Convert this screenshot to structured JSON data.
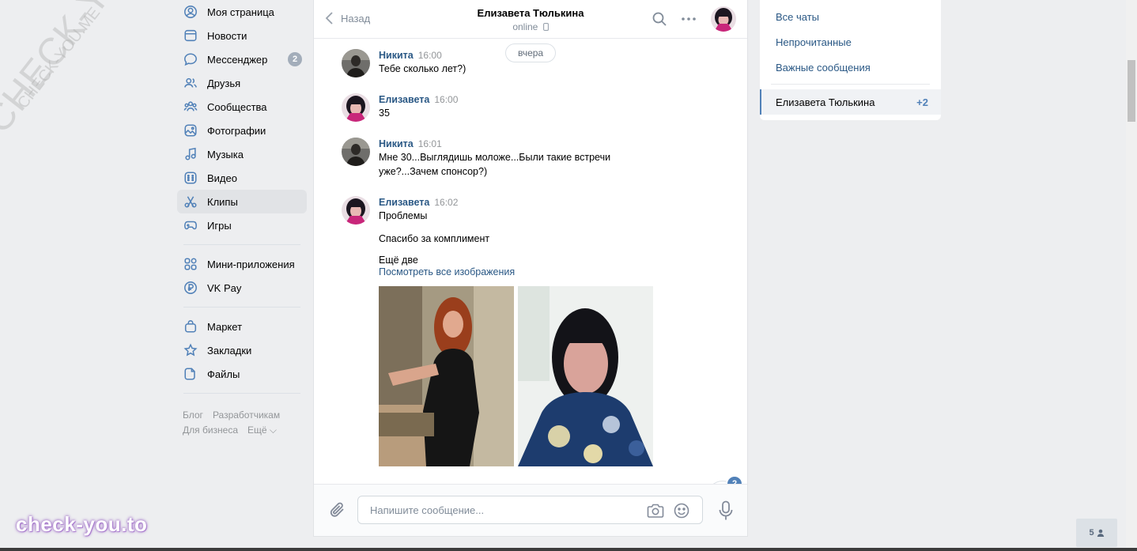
{
  "sidebar": {
    "items": [
      {
        "label": "Моя страница",
        "icon": "user-circle-icon"
      },
      {
        "label": "Новости",
        "icon": "newspaper-icon"
      },
      {
        "label": "Мессенджер",
        "icon": "message-icon",
        "badge": "2"
      },
      {
        "label": "Друзья",
        "icon": "friends-icon"
      },
      {
        "label": "Сообщества",
        "icon": "communities-icon"
      },
      {
        "label": "Фотографии",
        "icon": "photo-icon"
      },
      {
        "label": "Музыка",
        "icon": "music-icon"
      },
      {
        "label": "Видео",
        "icon": "video-icon"
      },
      {
        "label": "Клипы",
        "icon": "clips-icon"
      },
      {
        "label": "Игры",
        "icon": "gamepad-icon"
      },
      {
        "label": "Мини-приложения",
        "icon": "apps-icon"
      },
      {
        "label": "VK Pay",
        "icon": "vkpay-icon"
      },
      {
        "label": "Маркет",
        "icon": "market-icon"
      },
      {
        "label": "Закладки",
        "icon": "star-icon"
      },
      {
        "label": "Файлы",
        "icon": "file-icon"
      }
    ],
    "footer": [
      "Блог",
      "Разработчикам",
      "Для бизнеса",
      "Ещё ⌵"
    ]
  },
  "chat": {
    "back_label": "Назад",
    "peer_name": "Елизавета Тюлькина",
    "peer_status": "online",
    "day_label": "вчера",
    "messages": [
      {
        "author": "Никита",
        "time": "16:00",
        "text": "Тебе сколько лет?)"
      },
      {
        "author": "Елизавета",
        "time": "16:00",
        "text": "35"
      },
      {
        "author": "Никита",
        "time": "16:01",
        "text": "Мне 30...Выглядишь моложе...Были такие встречи уже?...Зачем спонсор?)"
      },
      {
        "author": "Елизавета",
        "time": "16:02",
        "text": "Проблемы",
        "text2": "Спасибо за комплимент",
        "text3": "Ещё две",
        "link": "Посмотреть все изображения"
      }
    ],
    "unread_badge": "2",
    "composer_placeholder": "Напишите сообщение..."
  },
  "right_panel": {
    "filters": [
      "Все чаты",
      "Непрочитанные",
      "Важные сообщения"
    ],
    "active_chat": {
      "name": "Елизавета Тюлькина",
      "count": "+2"
    }
  },
  "online_count": "5",
  "watermarks": {
    "diag_large": "CHECK-YOU.ME",
    "diag_small": "CHECK-YOU.ME",
    "brand": "check-you.to"
  },
  "colors": {
    "accent": "#5181b8",
    "link": "#2a5885",
    "bg": "#edeef0"
  }
}
